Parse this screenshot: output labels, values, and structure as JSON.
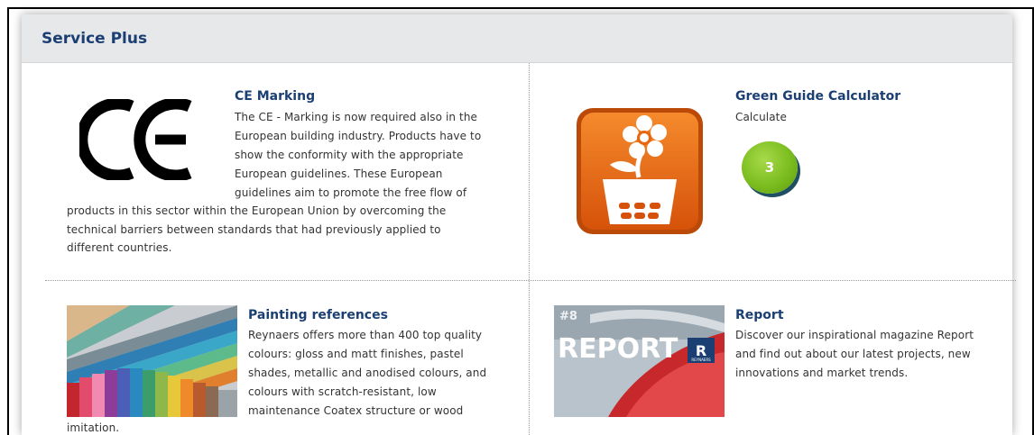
{
  "section": {
    "title": "Service Plus"
  },
  "ce_marking": {
    "title": "CE Marking",
    "logo_text": "CE",
    "lines": [
      "The CE - Marking is now required also in the",
      "European building industry. Products have to",
      "show the conformity with the appropriate",
      "European guidelines. These European",
      "guidelines aim to promote the free flow of",
      "products in this sector within the European Union by overcoming the",
      "technical barriers between standards that had previously applied to",
      "different countries."
    ]
  },
  "green_guide": {
    "title": "Green Guide Calculator",
    "link": "Calculate",
    "badge": "3",
    "icon": "flower-pot-calculator-icon"
  },
  "painting": {
    "title": "Painting references",
    "lines": [
      "Reynaers offers more than 400 top quality",
      "colours: gloss and matt finishes, pastel",
      "shades, metallic and anodised colours, and",
      "colours with scratch-resistant, low",
      "maintenance Coatex structure or wood",
      "imitation."
    ]
  },
  "report": {
    "title": "Report",
    "cover_issue": "#8",
    "cover_title": "REPORT",
    "cover_brand": "REYNAERS",
    "lines": [
      "Discover our inspirational magazine Report",
      "and find out about our latest projects,  new",
      "innovations and market trends."
    ]
  },
  "colors": {
    "title_blue": "#1c3f73",
    "header_gray": "#e7e8ea",
    "icon_orange": "#e8670e",
    "badge_green": "#7bbd1f"
  }
}
